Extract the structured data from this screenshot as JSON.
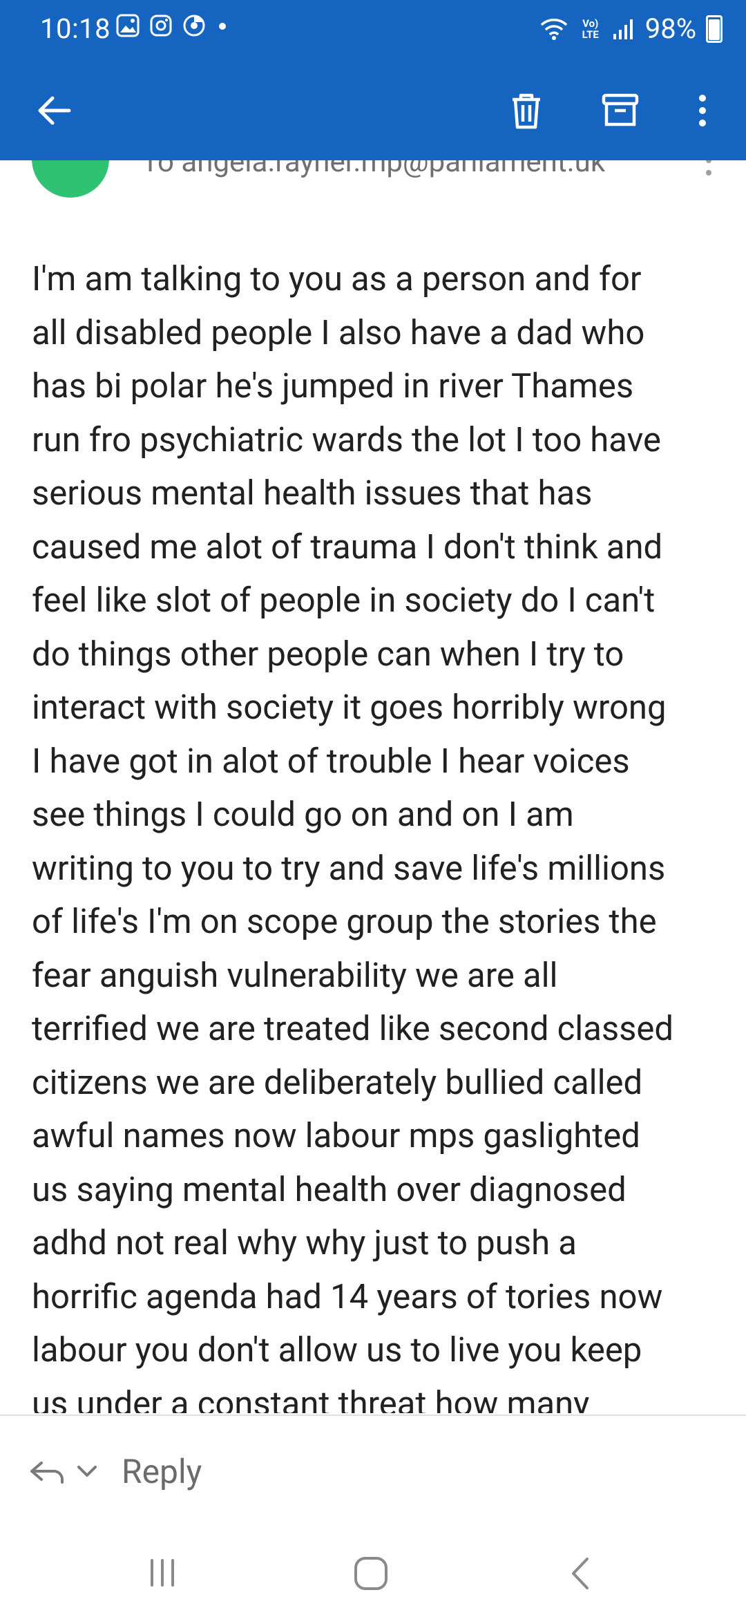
{
  "status_bar": {
    "time": "10:18",
    "network_label": "Vo) LTE",
    "battery": "98%"
  },
  "toolbar": {
    "back_icon": "arrow-left-icon",
    "delete_icon": "trash-icon",
    "archive_icon": "archive-icon",
    "more_icon": "more-vert-icon"
  },
  "header": {
    "to_line": "To angela.rayner.mp@parliament.uk"
  },
  "message": {
    "body": "I'm am talking to you as a person and for\nall disabled people I also have a dad who\nhas bi polar he's jumped in river Thames\nrun fro psychiatric wards the lot I too have\nserious mental health issues that has\ncaused me alot of trauma I don't think and\nfeel like slot of people in society do I can't\ndo things other people can when I try to\ninteract with society it goes horribly wrong\nI have got in alot of trouble I hear voices\nsee things I could go on and on I am\nwriting to you to try and save life's millions\nof life's I'm on scope group the stories the\nfear anguish vulnerability we are all\nterrified we are treated like second classed\ncitizens we are deliberately bullied called\nawful names now labour mps gaslighted\nus saying mental health over diagnosed\nadhd not real why why just to push a\nhorrific agenda had 14 years of tories now\nlabour you don't allow us to live you keep\nus under a constant threat how many"
  },
  "reply_bar": {
    "label": "Reply"
  },
  "colors": {
    "app_bar": "#1565c0",
    "avatar": "#2fc272",
    "body_text": "#212121",
    "secondary_text": "#707070"
  }
}
